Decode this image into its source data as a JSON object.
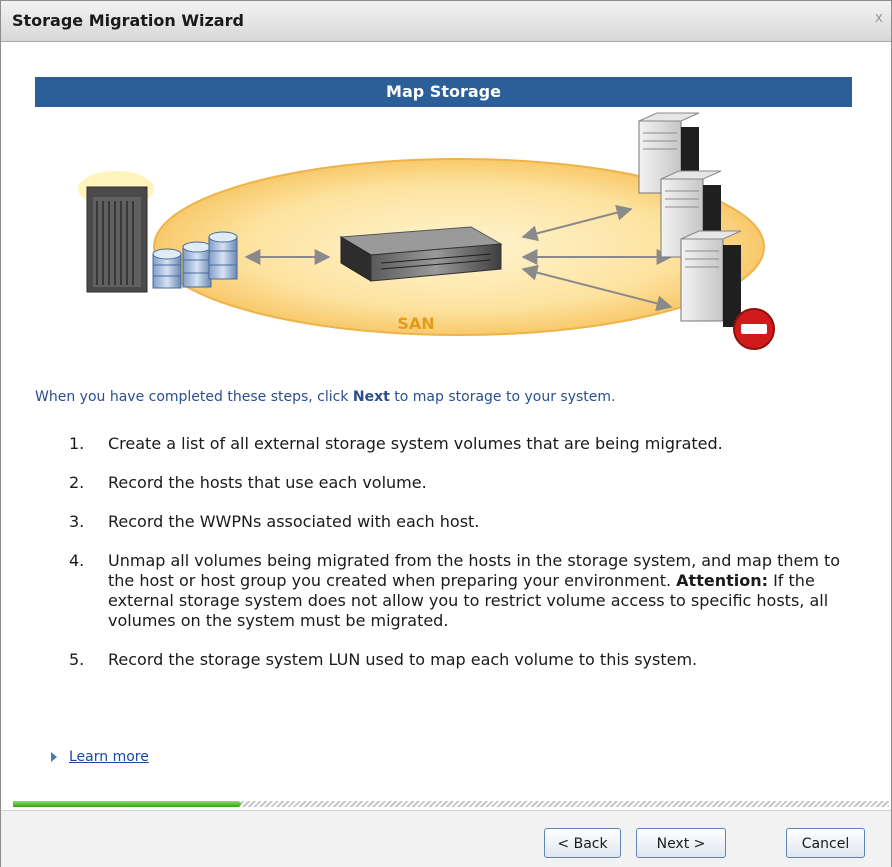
{
  "window": {
    "title": "Storage Migration Wizard",
    "close_label": "x"
  },
  "section": {
    "header": "Map Storage"
  },
  "diagram": {
    "san_label": "SAN"
  },
  "intro": {
    "before": "When you have completed these steps, click ",
    "emphasis": "Next",
    "after": " to map storage to your system."
  },
  "steps": [
    {
      "num": "1.",
      "text": "Create a list of all external storage system volumes that are being migrated."
    },
    {
      "num": "2.",
      "text": "Record the hosts that use each volume."
    },
    {
      "num": "3.",
      "text": "Record the WWPNs associated with each host."
    },
    {
      "num": "4.",
      "text": "Unmap all volumes being migrated from the hosts in the storage system, and map them to the host or host group you created when preparing your environment.",
      "attention_label": "Attention:",
      "attention_text": " If the external storage system does not allow you to restrict volume access to specific hosts, all volumes on the system must be migrated."
    },
    {
      "num": "5.",
      "text": "Record the storage system LUN used to map each volume to this system."
    }
  ],
  "learn_more": "Learn more",
  "progress": {
    "fraction": 0.26
  },
  "buttons": {
    "back": "< Back",
    "next": "Next >",
    "cancel": "Cancel"
  }
}
